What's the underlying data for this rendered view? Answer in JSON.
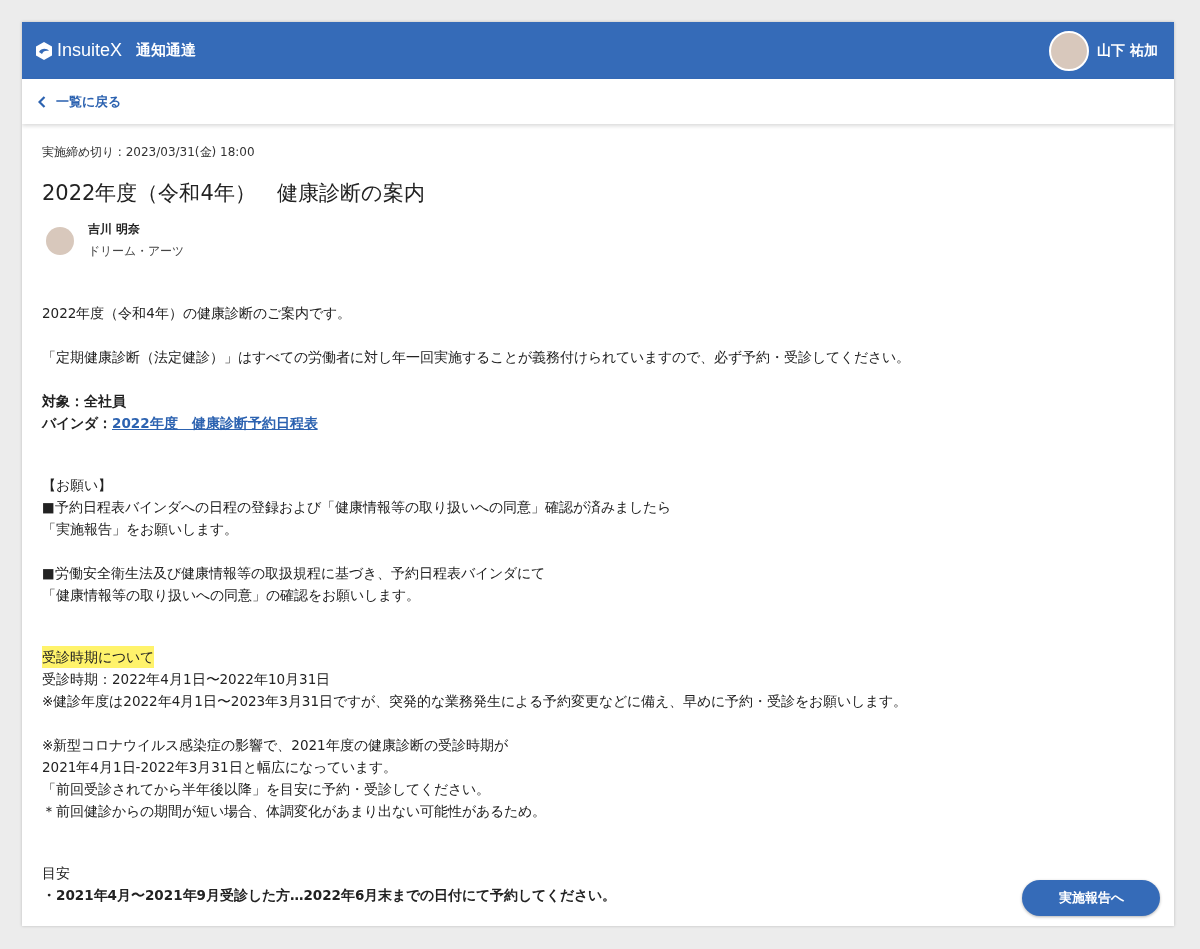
{
  "header": {
    "brand": "InsuiteX",
    "app_title": "通知通達",
    "user_name": "山下 祐加"
  },
  "back_link": "一覧に戻る",
  "notice": {
    "deadline": "実施締め切り : 2023/03/31(金) 18:00",
    "title": "2022年度（令和4年）　健康診断の案内",
    "author": {
      "name": "吉川 明奈",
      "organization": "ドリーム・アーツ"
    }
  },
  "body_sections": [
    {
      "paragraphs": [
        [
          {
            "kind": "text",
            "text": "2022年度（令和4年）の健康診断のご案内です。"
          }
        ],
        [
          {
            "kind": "text",
            "text": "「定期健康診断（法定健診）」はすべての労働者に対し年一回実施することが義務付けられていますので、必ず予約・受診してください。"
          }
        ],
        [
          {
            "kind": "bold",
            "text": "対象：全社員"
          },
          {
            "kind": "label_link",
            "label": "バインダ：",
            "link": "2022年度　健康診断予約日程表"
          }
        ]
      ]
    },
    {
      "paragraphs": [
        [
          {
            "kind": "text",
            "text": "【お願い】"
          },
          {
            "kind": "text",
            "text": "■予約日程表バインダへの日程の登録および「健康情報等の取り扱いへの同意」確認が済みましたら"
          },
          {
            "kind": "text",
            "text": "「実施報告」をお願いします。"
          }
        ],
        [
          {
            "kind": "text",
            "text": "■労働安全衛生法及び健康情報等の取扱規程に基づき、予約日程表バインダにて"
          },
          {
            "kind": "text",
            "text": "「健康情報等の取り扱いへの同意」の確認をお願いします。"
          }
        ]
      ]
    },
    {
      "paragraphs": [
        [
          {
            "kind": "highlight",
            "text": "受診時期について"
          },
          {
            "kind": "text",
            "text": "受診時期：2022年4月1日〜2022年10月31日"
          },
          {
            "kind": "text",
            "text": " ※健診年度は2022年4月1日〜2023年3月31日ですが、突発的な業務発生による予約変更などに備え、早めに予約・受診をお願いします。"
          }
        ],
        [
          {
            "kind": "text",
            "text": "※新型コロナウイルス感染症の影響で、2021年度の健康診断の受診時期が"
          },
          {
            "kind": "text",
            "text": "2021年4月1日-2022年3月31日と幅広になっています。"
          },
          {
            "kind": "text",
            "text": "「前回受診されてから半年後以降」を目安に予約・受診してください。"
          },
          {
            "kind": "text",
            "text": "＊前回健診からの期間が短い場合、体調変化があまり出ない可能性があるため。"
          }
        ]
      ]
    },
    {
      "paragraphs": [
        [
          {
            "kind": "text",
            "text": "目安"
          },
          {
            "kind": "bold",
            "text": "・2021年4月〜2021年9月受診した方…2022年6月末までの日付にて予約してください。"
          }
        ]
      ]
    }
  ],
  "report_button": "実施報告へ"
}
